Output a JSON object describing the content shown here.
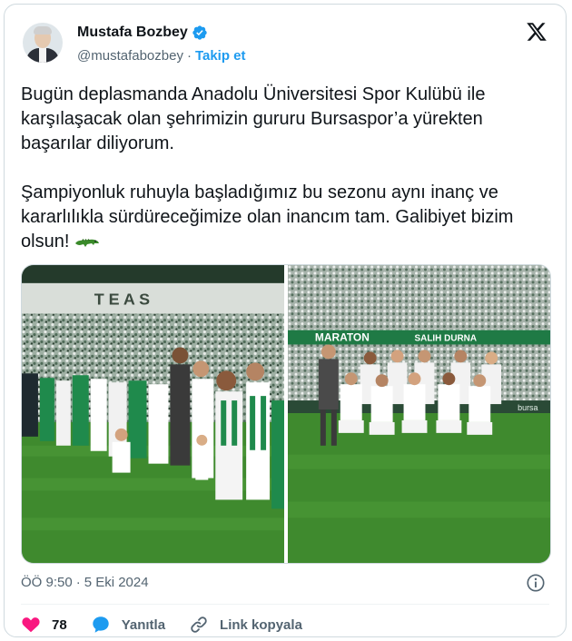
{
  "author": {
    "name": "Mustafa Bozbey",
    "handle": "@mustafabozbey",
    "separator": "·",
    "follow_label": "Takip et"
  },
  "tweet": {
    "paragraph1": "Bugün deplasmanda Anadolu Üniversitesi Spor Kulübü ile karşılaşacak olan şehrimizin gururu Bursaspor’a yürekten başarılar diliyorum.",
    "paragraph2": "Şampiyonluk ruhuyla başladığımız bu sezonu aynı inanç ve kararlılıkla sürdüreceğimize olan inancım tam. Galibiyet bizim olsun! ",
    "time": "ÖÖ 9:50",
    "dot": "·",
    "date": "5 Eki 2024"
  },
  "photos": {
    "left_banner_text": "T E A S",
    "right_banner_text": "MARATON",
    "right_banner_text2": "SALIH DURNA",
    "right_board_text": "bursa"
  },
  "actions": {
    "like_count": "78",
    "reply_label": "Yanıtla",
    "copy_label": "Link kopyala"
  },
  "colors": {
    "accent": "#1d9bf0",
    "like": "#f91880",
    "muted": "#536471",
    "pitch": "#3f8a2e",
    "team_green": "#1f8a4c"
  }
}
